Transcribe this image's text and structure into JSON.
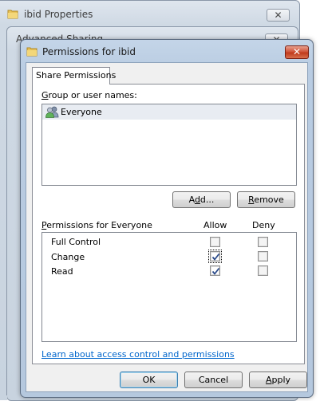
{
  "back_window_1": {
    "title": "ibid Properties"
  },
  "back_window_2": {
    "title": "Advanced Sharing"
  },
  "dialog": {
    "title": "Permissions for ibid",
    "tabs": [
      {
        "label": "Share Permissions"
      }
    ],
    "group_label_pre": "",
    "group_label_key": "G",
    "group_label_post": "roup or user names:",
    "users": [
      {
        "name": "Everyone",
        "icon": "users-group-icon"
      }
    ],
    "add_pre": "A",
    "add_key": "d",
    "add_post": "d...",
    "remove_key": "R",
    "remove_post": "emove",
    "perm_label_pre": "",
    "perm_label_key": "P",
    "perm_label_post": "ermissions for Everyone",
    "col_allow": "Allow",
    "col_deny": "Deny",
    "permissions": [
      {
        "name": "Full Control",
        "allow": false,
        "deny": false
      },
      {
        "name": "Change",
        "allow": true,
        "deny": false
      },
      {
        "name": "Read",
        "allow": true,
        "deny": false
      }
    ],
    "link": "Learn about access control and permissions",
    "ok_label": "OK",
    "cancel_label": "Cancel",
    "apply_key": "A",
    "apply_post": "pply"
  },
  "colors": {
    "link": "#0066cc",
    "close_button": "#c8452a"
  }
}
